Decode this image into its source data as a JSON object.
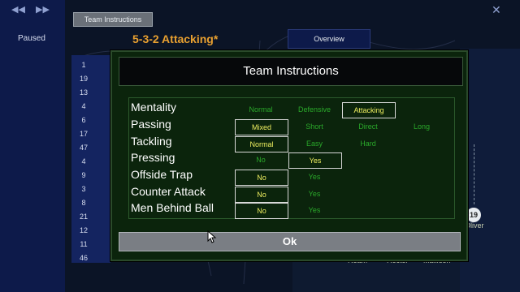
{
  "nav": {
    "back_icon": "back-arrow-icon",
    "forward_icon": "forward-arrow-icon",
    "status": "Paused"
  },
  "header": {
    "tab_label": "Team Instructions",
    "tactic_name": "5-3-2 Attacking*",
    "overview_tab": "Overview",
    "close_icon": "close-icon"
  },
  "squad_numbers": [
    "1",
    "19",
    "13",
    "4",
    "6",
    "17",
    "47",
    "4",
    "9",
    "3",
    "8",
    "21",
    "12",
    "11",
    "46"
  ],
  "pitch": {
    "player_badge": "19",
    "player_name": "Oliver",
    "bottom_names": [
      "Ream",
      "Hector",
      "Mawson"
    ]
  },
  "dialog": {
    "title": "Team Instructions",
    "rows": [
      {
        "label": "Mentality",
        "options": [
          "Normal",
          "Defensive",
          "Attacking"
        ],
        "selected": 2
      },
      {
        "label": "Passing",
        "options": [
          "Mixed",
          "Short",
          "Direct",
          "Long"
        ],
        "selected": 0
      },
      {
        "label": "Tackling",
        "options": [
          "Normal",
          "Easy",
          "Hard"
        ],
        "selected": 0
      },
      {
        "label": "Pressing",
        "options": [
          "No",
          "Yes"
        ],
        "selected": 1
      },
      {
        "label": "Offside Trap",
        "options": [
          "No",
          "Yes"
        ],
        "selected": 0
      },
      {
        "label": "Counter Attack",
        "options": [
          "No",
          "Yes"
        ],
        "selected": 0
      },
      {
        "label": "Men Behind Ball",
        "options": [
          "No",
          "Yes"
        ],
        "selected": 0
      }
    ],
    "ok_label": "Ok"
  },
  "colors": {
    "option_unselected": "#2aa82a",
    "option_selected": "#f0f060",
    "dialog_bg": "#0b240c"
  }
}
